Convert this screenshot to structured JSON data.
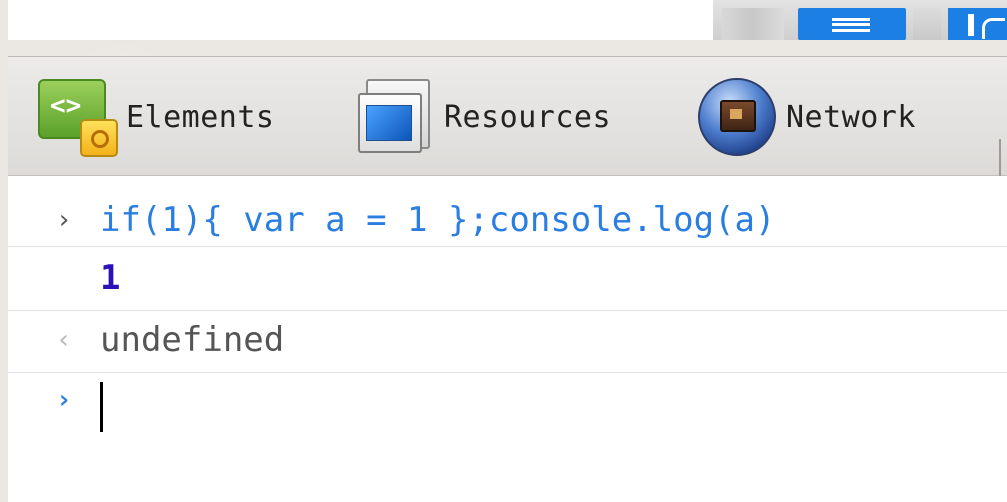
{
  "toolbar": {
    "tabs": [
      {
        "label": "Elements",
        "icon": "elements-icon"
      },
      {
        "label": "Resources",
        "icon": "resources-icon"
      },
      {
        "label": "Network",
        "icon": "network-icon"
      }
    ]
  },
  "console": {
    "input_prompt": "›",
    "input_text": "if(1){ var a = 1 };console.log(a)",
    "log_output": "1",
    "result_prompt": "‹",
    "result_text": "undefined",
    "active_prompt": "›",
    "active_value": ""
  },
  "colors": {
    "input_text": "#2a7de1",
    "log_output": "#2a12b8",
    "result_text": "#555555",
    "accent_blue": "#1b7fe4"
  }
}
